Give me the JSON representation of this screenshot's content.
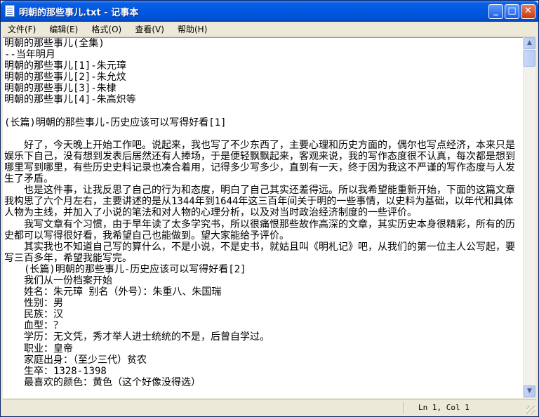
{
  "window": {
    "title": "明朝的那些事儿.txt - 记事本"
  },
  "title_buttons": {
    "minimize": "_",
    "maximize": "□",
    "close": "✕"
  },
  "menu": {
    "items": [
      "文件(F)",
      "编辑(E)",
      "格式(O)",
      "查看(V)",
      "帮助(H)"
    ]
  },
  "content": {
    "lines": [
      "明朝的那些事儿(全集)",
      "--当年明月",
      "明朝的那些事儿[1]-朱元璋",
      "明朝的那些事儿[2]-朱允炆",
      "明朝的那些事儿[3]-朱棣",
      "明朝的那些事儿[4]-朱高炽等",
      "",
      "(长篇)明朝的那些事儿-历史应该可以写得好看[1]",
      "",
      "　　好了，今天晚上开始工作吧。说起来，我也写了不少东西了，主要心理和历史方面的，偶尔也写点经济，本来只是娱乐下自己，没有想到发表后居然还有人捧场，于是便轻飘飘起来，客观来说，我的写作态度很不认真，每次都是想到哪里写到哪里，有些历史史料记录也凑合着用，记得多少写多少，直到有一天，终于因为我这不严谨的写作态度与人发生了矛盾。",
      "　　也是这件事，让我反思了自己的行为和态度，明白了自己其实还差得远。所以我希望能重新开始，下面的这篇文章我构思了六个月左右，主要讲述的是从1344年到1644年这三百年间关于明的一些事情，以史料为基础，以年代和具体人物为主线，并加入了小说的笔法和对人物的心理分析，以及对当时政治经济制度的一些评价。",
      "　　我写文章有个习惯，由于早年读了太多学究书，所以很痛恨那些故作高深的文章，其实历史本身很精彩，所有的历史都可以写得很好看，我希望自己也能做到。望大家能给予评价。",
      "　　其实我也不知道自己写的算什么，不是小说，不是史书，就姑且叫《明札记》吧，从我们的第一位主人公写起，要写三百多年，希望我能写完。",
      "　　(长篇)明朝的那些事儿-历史应该可以写得好看[2]",
      "　　我们从一份档案开始",
      "　　姓名：朱元璋 别名（外号）：朱重八、朱国瑞",
      "　　性别：男",
      "　　民族：汉",
      "　　血型：？",
      "　　学历：无文凭，秀才举人进士统统的不是，后曾自学过。",
      "　　职业：皇帝",
      "　　家庭出身：（至少三代）贫农",
      "　　生卒：1328-1398",
      "　　最喜欢的颜色：黄色（这个好像没得选）"
    ]
  },
  "scrollbar": {
    "up_arrow": "▲",
    "down_arrow": "▼"
  },
  "status": {
    "position": "Ln 1, Col 1"
  }
}
